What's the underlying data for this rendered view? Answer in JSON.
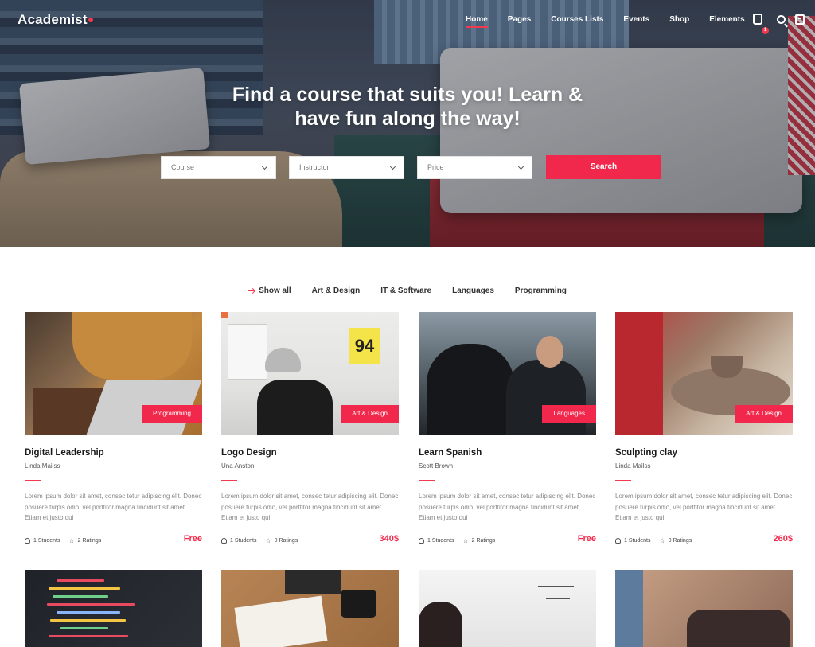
{
  "brand": {
    "name": "Academist",
    "accent": "#f1284b"
  },
  "nav": {
    "items": [
      {
        "label": "Home",
        "active": true
      },
      {
        "label": "Pages"
      },
      {
        "label": "Courses Lists"
      },
      {
        "label": "Events"
      },
      {
        "label": "Shop"
      },
      {
        "label": "Elements"
      }
    ],
    "cart_count": "1",
    "icons": [
      "shopping-bag-icon",
      "search-icon",
      "side-menu-icon"
    ]
  },
  "hero": {
    "title_line1": "Find a course that suits you! Learn &",
    "title_line2": "have fun along the way!",
    "search": {
      "course": "Course",
      "instructor": "Instructor",
      "price": "Price",
      "button": "Search"
    }
  },
  "filters": [
    "Show all",
    "Art & Design",
    "IT & Software",
    "Languages",
    "Programming"
  ],
  "courses": [
    {
      "title": "Digital Leadership",
      "author": "Linda Mailss",
      "tag": "Programming",
      "desc": "Lorem ipsum dolor sit amet, consec tetur adipiscing elit. Donec posuere turpis odio, vel porttitor magna tincidunt sit amet. Etiam et justo qui",
      "students": "1 Students",
      "ratings": "2 Ratings",
      "price": "Free"
    },
    {
      "title": "Logo Design",
      "author": "Una Anston",
      "tag": "Art & Design",
      "desc": "Lorem ipsum dolor sit amet, consec tetur adipiscing elit. Donec posuere turpis odio, vel porttitor magna tincidunt sit amet. Etiam et justo qui",
      "students": "1 Students",
      "ratings": "0 Ratings",
      "price": "340$"
    },
    {
      "title": "Learn Spanish",
      "author": "Scott Brown",
      "tag": "Languages",
      "desc": "Lorem ipsum dolor sit amet, consec tetur adipiscing elit. Donec posuere turpis odio, vel porttitor magna tincidunt sit amet. Etiam et justo qui",
      "students": "1 Students",
      "ratings": "2 Ratings",
      "price": "Free"
    },
    {
      "title": "Sculpting clay",
      "author": "Linda Mailss",
      "tag": "Art & Design",
      "desc": "Lorem ipsum dolor sit amet, consec tetur adipiscing elit. Donec posuere turpis odio, vel porttitor magna tincidunt sit amet. Etiam et justo qui",
      "students": "1 Students",
      "ratings": "0 Ratings",
      "price": "260$"
    }
  ],
  "thumb_labels": {
    "poster": "94"
  }
}
